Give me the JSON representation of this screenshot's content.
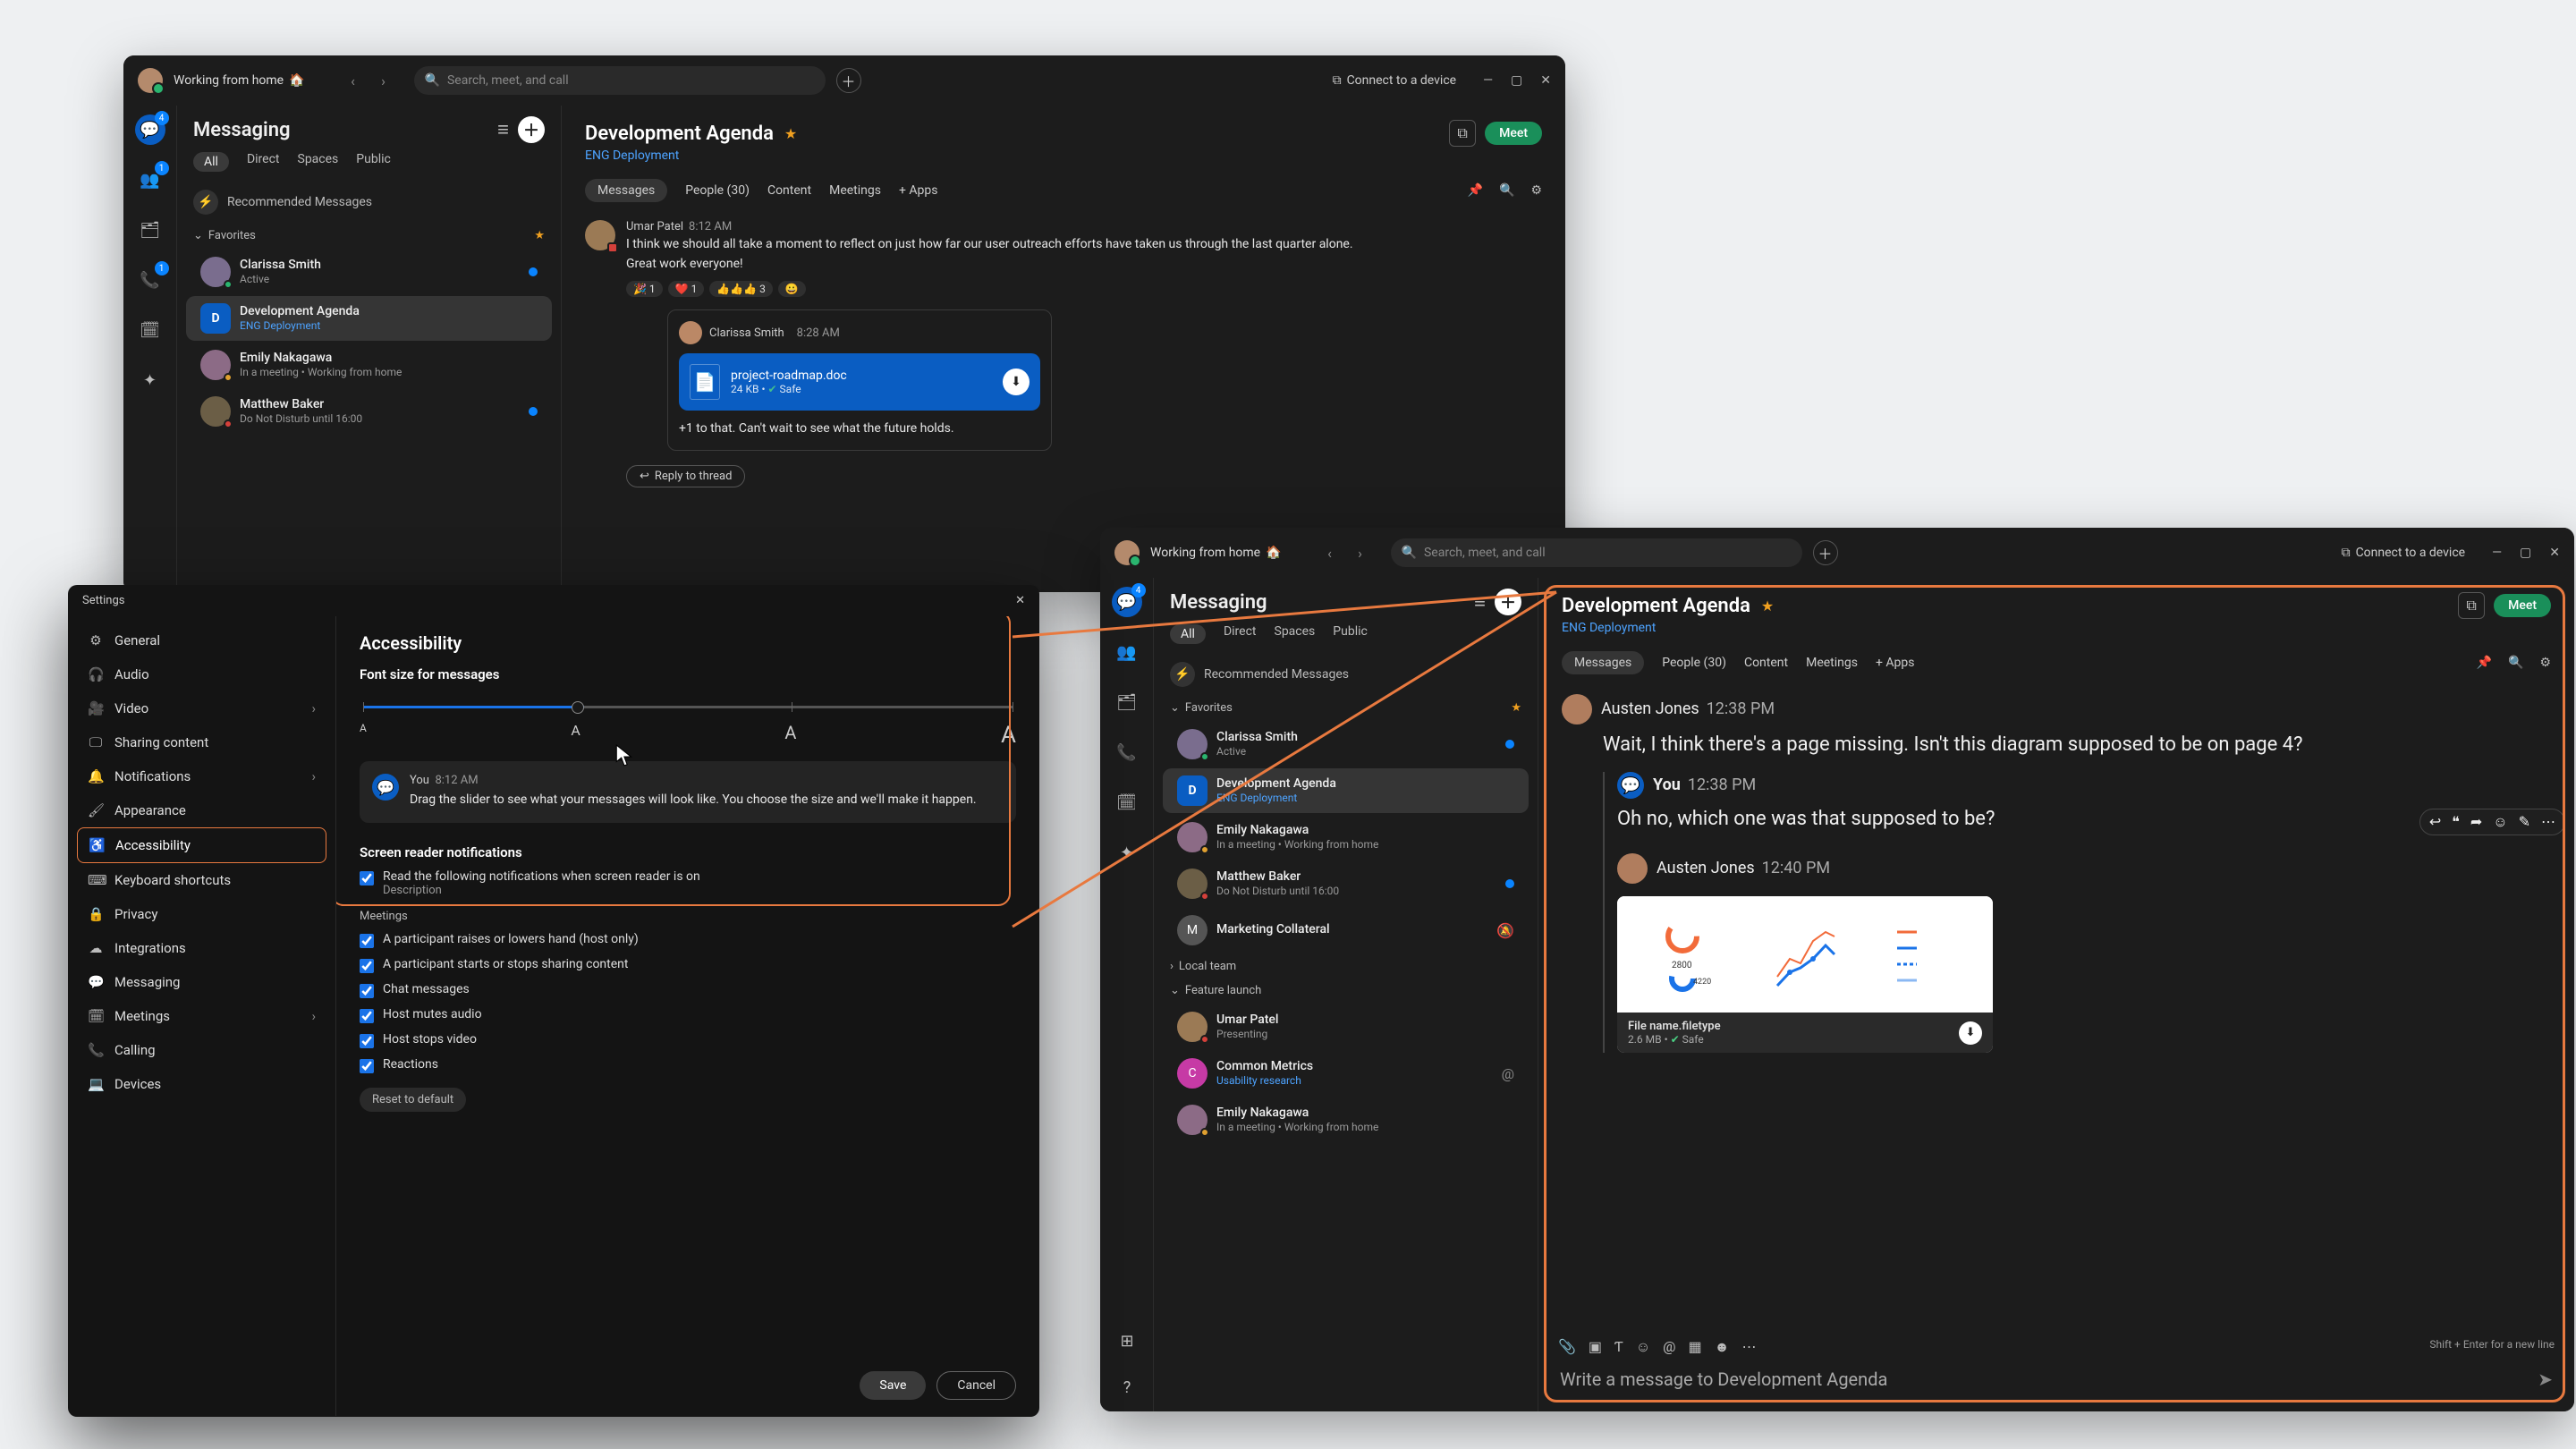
{
  "header": {
    "status": "Working from home",
    "status_emoji": "🏠",
    "search_placeholder": "Search, meet, and call",
    "connect": "Connect to a device"
  },
  "rail": {
    "messaging_badge": "4",
    "contacts_badge": "1",
    "call_badge": "1"
  },
  "list": {
    "title": "Messaging",
    "filters": {
      "all": "All",
      "direct": "Direct",
      "spaces": "Spaces",
      "public": "Public"
    },
    "recommended": "Recommended Messages",
    "favorites_label": "Favorites",
    "local_team_label": "Local team",
    "feature_launch_label": "Feature launch",
    "items": [
      {
        "title": "Clarissa Smith",
        "sub": "Active"
      },
      {
        "title": "Development Agenda",
        "sub": "ENG Deployment"
      },
      {
        "title": "Emily Nakagawa",
        "sub": "In a meeting  •  Working from home"
      },
      {
        "title": "Matthew Baker",
        "sub": "Do Not Disturb until 16:00"
      },
      {
        "title": "Marketing Collateral",
        "sub": ""
      },
      {
        "title": "Umar Patel",
        "sub": "Presenting"
      },
      {
        "title": "Common Metrics",
        "sub": "Usability research"
      },
      {
        "title": "Emily Nakagawa",
        "sub": "In a meeting  •  Working from home"
      }
    ]
  },
  "convA": {
    "title": "Development Agenda",
    "crumb": "ENG Deployment",
    "meet": "Meet",
    "tabs": {
      "messages": "Messages",
      "people": "People (30)",
      "content": "Content",
      "meetings": "Meetings",
      "apps": "+  Apps"
    },
    "msgs": {
      "umar": {
        "who": "Umar Patel",
        "time": "8:12 AM",
        "text": "I think we should all take a moment to reflect on just how far our user outreach efforts have taken us through the last quarter alone. Great work everyone!",
        "reactions": [
          "🎉 1",
          "❤️ 1",
          "👍👍👍 3",
          "😀"
        ]
      },
      "clarissa": {
        "who": "Clarissa Smith",
        "time": "8:28 AM",
        "file": {
          "name": "project-roadmap.doc",
          "size": "24 KB",
          "safe": "Safe"
        },
        "text": "+1 to that. Can't wait to see what the future holds."
      },
      "reply_label": "Reply to thread"
    }
  },
  "convB": {
    "title": "Development Agenda",
    "crumb": "ENG Deployment",
    "meet": "Meet",
    "msgs": {
      "a1": {
        "who": "Austen Jones",
        "time": "12:38 PM",
        "text": "Wait, I think there's a page missing. Isn't this diagram supposed to be on page 4?"
      },
      "you": {
        "who": "You",
        "time": "12:38 PM",
        "text": "Oh no, which one was that supposed to be?"
      },
      "a2": {
        "who": "Austen Jones",
        "time": "12:40 PM"
      },
      "attach": {
        "name": "File name.filetype",
        "size": "2.6 MB",
        "safe": "Safe"
      }
    },
    "composer": {
      "placeholder": "Write a message to Development Agenda",
      "hint": "Shift + Enter for a new line"
    }
  },
  "settings": {
    "title": "Settings",
    "nav": [
      "General",
      "Audio",
      "Video",
      "Sharing content",
      "Notifications",
      "Appearance",
      "Accessibility",
      "Keyboard shortcuts",
      "Privacy",
      "Integrations",
      "Messaging",
      "Meetings",
      "Calling",
      "Devices"
    ],
    "accessibility": {
      "heading": "Accessibility",
      "font_h": "Font size for messages",
      "preview_who": "You",
      "preview_time": "8:12 AM",
      "preview_body": "Drag the slider to see what your messages will look like. You choose the size and we'll make it happen.",
      "srn_heading": "Screen reader notifications",
      "srn_top": "Read the following notifications when screen reader is on",
      "srn_sub": "Description",
      "meet_h": "Meetings",
      "checks": [
        "A participant raises or lowers hand (host only)",
        "A participant starts or stops sharing content",
        "Chat messages",
        "Host mutes audio",
        "Host stops video",
        "Reactions"
      ],
      "reset": "Reset to default",
      "save": "Save",
      "cancel": "Cancel"
    }
  }
}
